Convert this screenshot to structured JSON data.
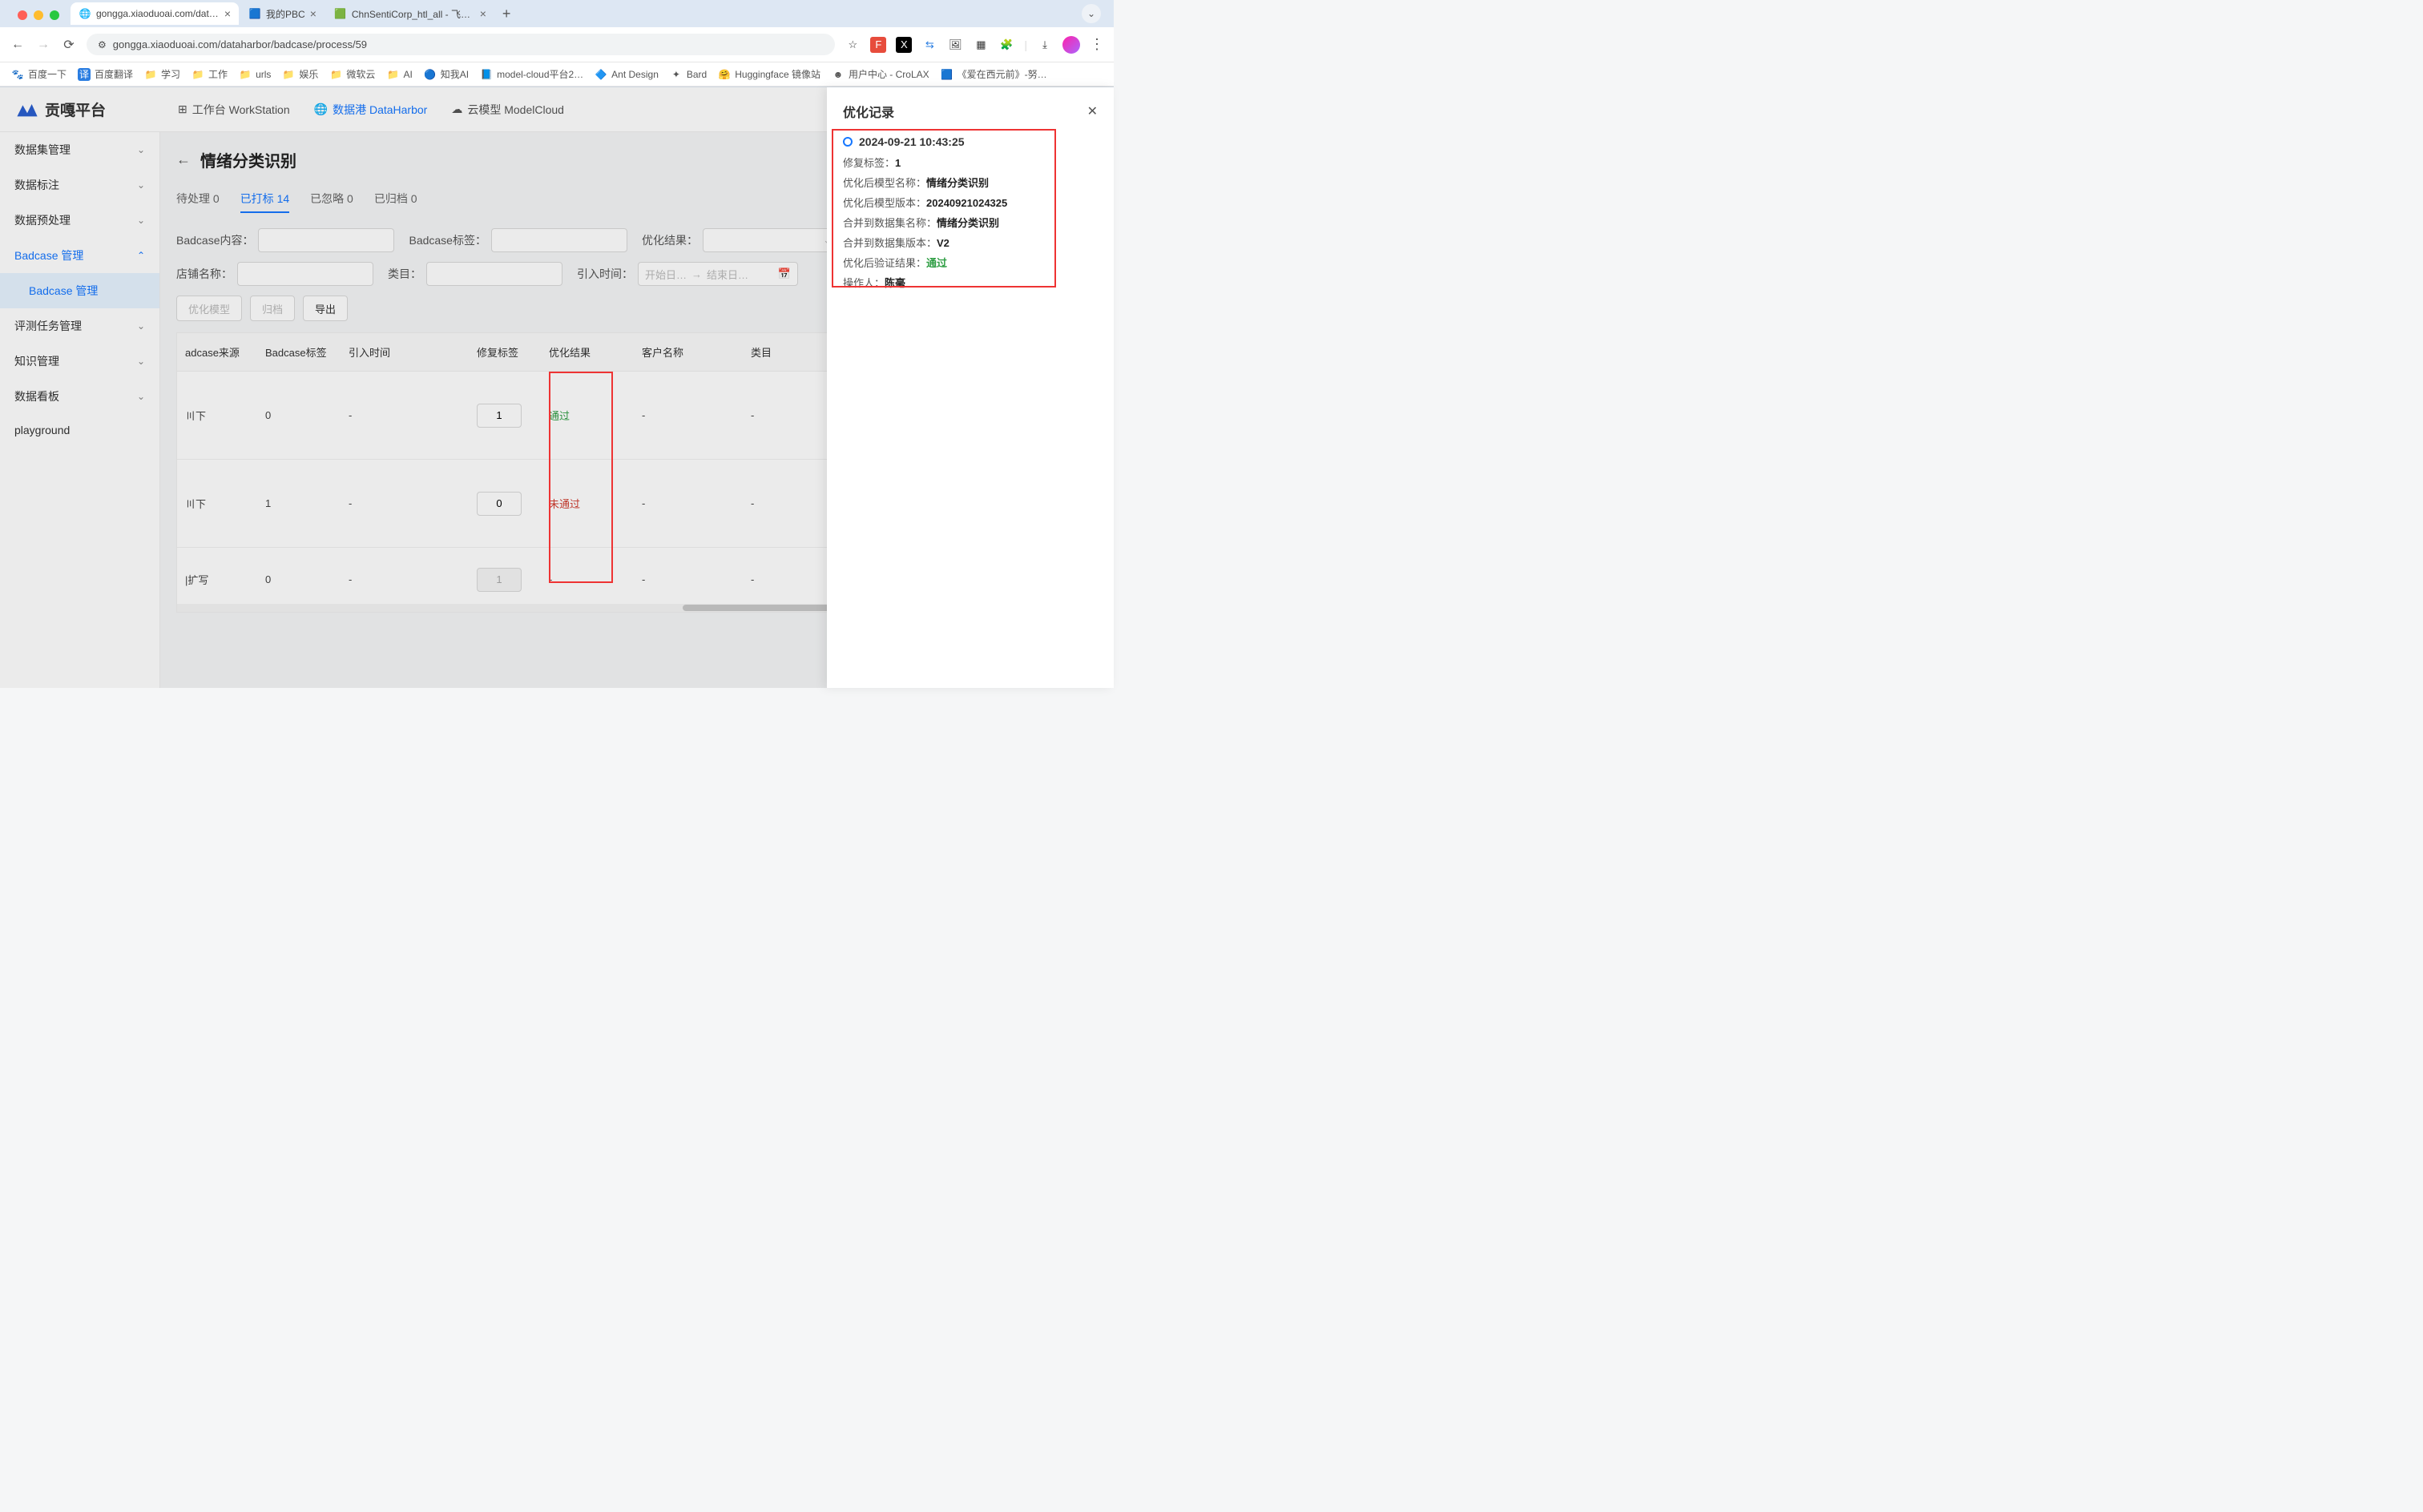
{
  "browser": {
    "tabs": [
      {
        "title": "gongga.xiaoduoai.com/datah",
        "favicon": "🌐"
      },
      {
        "title": "我的PBC",
        "favicon": "🟦"
      },
      {
        "title": "ChnSentiCorp_htl_all - 飞书云",
        "favicon": "🟩"
      }
    ],
    "url": "gongga.xiaoduoai.com/dataharbor/badcase/process/59",
    "bookmarks": [
      {
        "icon": "🐾",
        "label": "百度一下"
      },
      {
        "icon": "译",
        "label": "百度翻译",
        "iconbg": "#2a7de1"
      },
      {
        "icon": "📁",
        "label": "学习"
      },
      {
        "icon": "📁",
        "label": "工作"
      },
      {
        "icon": "📁",
        "label": "urls"
      },
      {
        "icon": "📁",
        "label": "娱乐"
      },
      {
        "icon": "📁",
        "label": "微软云"
      },
      {
        "icon": "📁",
        "label": "AI"
      },
      {
        "icon": "🔵",
        "label": "知我AI"
      },
      {
        "icon": "📘",
        "label": "model-cloud平台2…"
      },
      {
        "icon": "🔷",
        "label": "Ant Design"
      },
      {
        "icon": "✦",
        "label": "Bard"
      },
      {
        "icon": "🤗",
        "label": "Huggingface 镜像站"
      },
      {
        "icon": "☻",
        "label": "用户中心 - CroLAX"
      },
      {
        "icon": "🟦",
        "label": "《爱在西元前》-努…"
      }
    ]
  },
  "app": {
    "logo_text": "贡嘎平台",
    "nav": [
      {
        "label": "工作台 WorkStation"
      },
      {
        "label": "数据港 DataHarbor"
      },
      {
        "label": "云模型 ModelCloud"
      }
    ],
    "sidebar": {
      "items": [
        {
          "label": "数据集管理"
        },
        {
          "label": "数据标注"
        },
        {
          "label": "数据预处理"
        },
        {
          "label": "Badcase 管理",
          "expanded": true,
          "children": [
            {
              "label": "Badcase 管理"
            }
          ]
        },
        {
          "label": "评测任务管理"
        },
        {
          "label": "知识管理"
        },
        {
          "label": "数据看板"
        },
        {
          "label": "playground",
          "no_chevron": true
        }
      ]
    }
  },
  "page": {
    "title": "情绪分类识别",
    "sub_tabs": [
      {
        "label": "待处理 0"
      },
      {
        "label": "已打标 14"
      },
      {
        "label": "已忽略 0"
      },
      {
        "label": "已归档 0"
      }
    ],
    "filters": {
      "content_label": "Badcase内容：",
      "tag_label": "Badcase标签：",
      "result_label": "优化结果：",
      "shop_label": "店铺名称：",
      "category_label": "类目：",
      "import_time_label": "引入时间：",
      "date_start_ph": "开始日…",
      "date_sep": "→",
      "date_end_ph": "结束日…"
    },
    "buttons": {
      "optimize": "优化模型",
      "archive": "归档",
      "export": "导出"
    },
    "columns": {
      "source": "adcase来源",
      "tag": "Badcase标签",
      "time": "引入时间",
      "fixtag": "修复标签",
      "result": "优化结果",
      "client": "客户名称",
      "category": "类目"
    },
    "rows": [
      {
        "source": "〣下",
        "tag": "0",
        "time": "-",
        "fixtag": "1",
        "result": "通过",
        "result_class": "pass",
        "client": "-",
        "category": "-"
      },
      {
        "source": "〣下",
        "tag": "1",
        "time": "-",
        "fixtag": "0",
        "result": "未通过",
        "result_class": "fail",
        "client": "-",
        "category": "-"
      },
      {
        "source": "|扩写",
        "tag": "0",
        "time": "-",
        "fixtag": "1",
        "fixtag_disabled": true,
        "result": "-",
        "client": "-",
        "category": "-"
      }
    ]
  },
  "drawer": {
    "title": "优化记录",
    "record": {
      "timestamp": "2024-09-21 10:43:25",
      "fix_tag_label": "修复标签：",
      "fix_tag": "1",
      "model_name_label": "优化后模型名称：",
      "model_name": "情绪分类识别",
      "model_ver_label": "优化后模型版本：",
      "model_ver": "20240921024325",
      "dataset_name_label": "合并到数据集名称：",
      "dataset_name": "情绪分类识别",
      "dataset_ver_label": "合并到数据集版本：",
      "dataset_ver": "V2",
      "verify_label": "优化后验证结果：",
      "verify": "通过",
      "operator_label": "操作人：",
      "operator": "陈毫"
    }
  }
}
